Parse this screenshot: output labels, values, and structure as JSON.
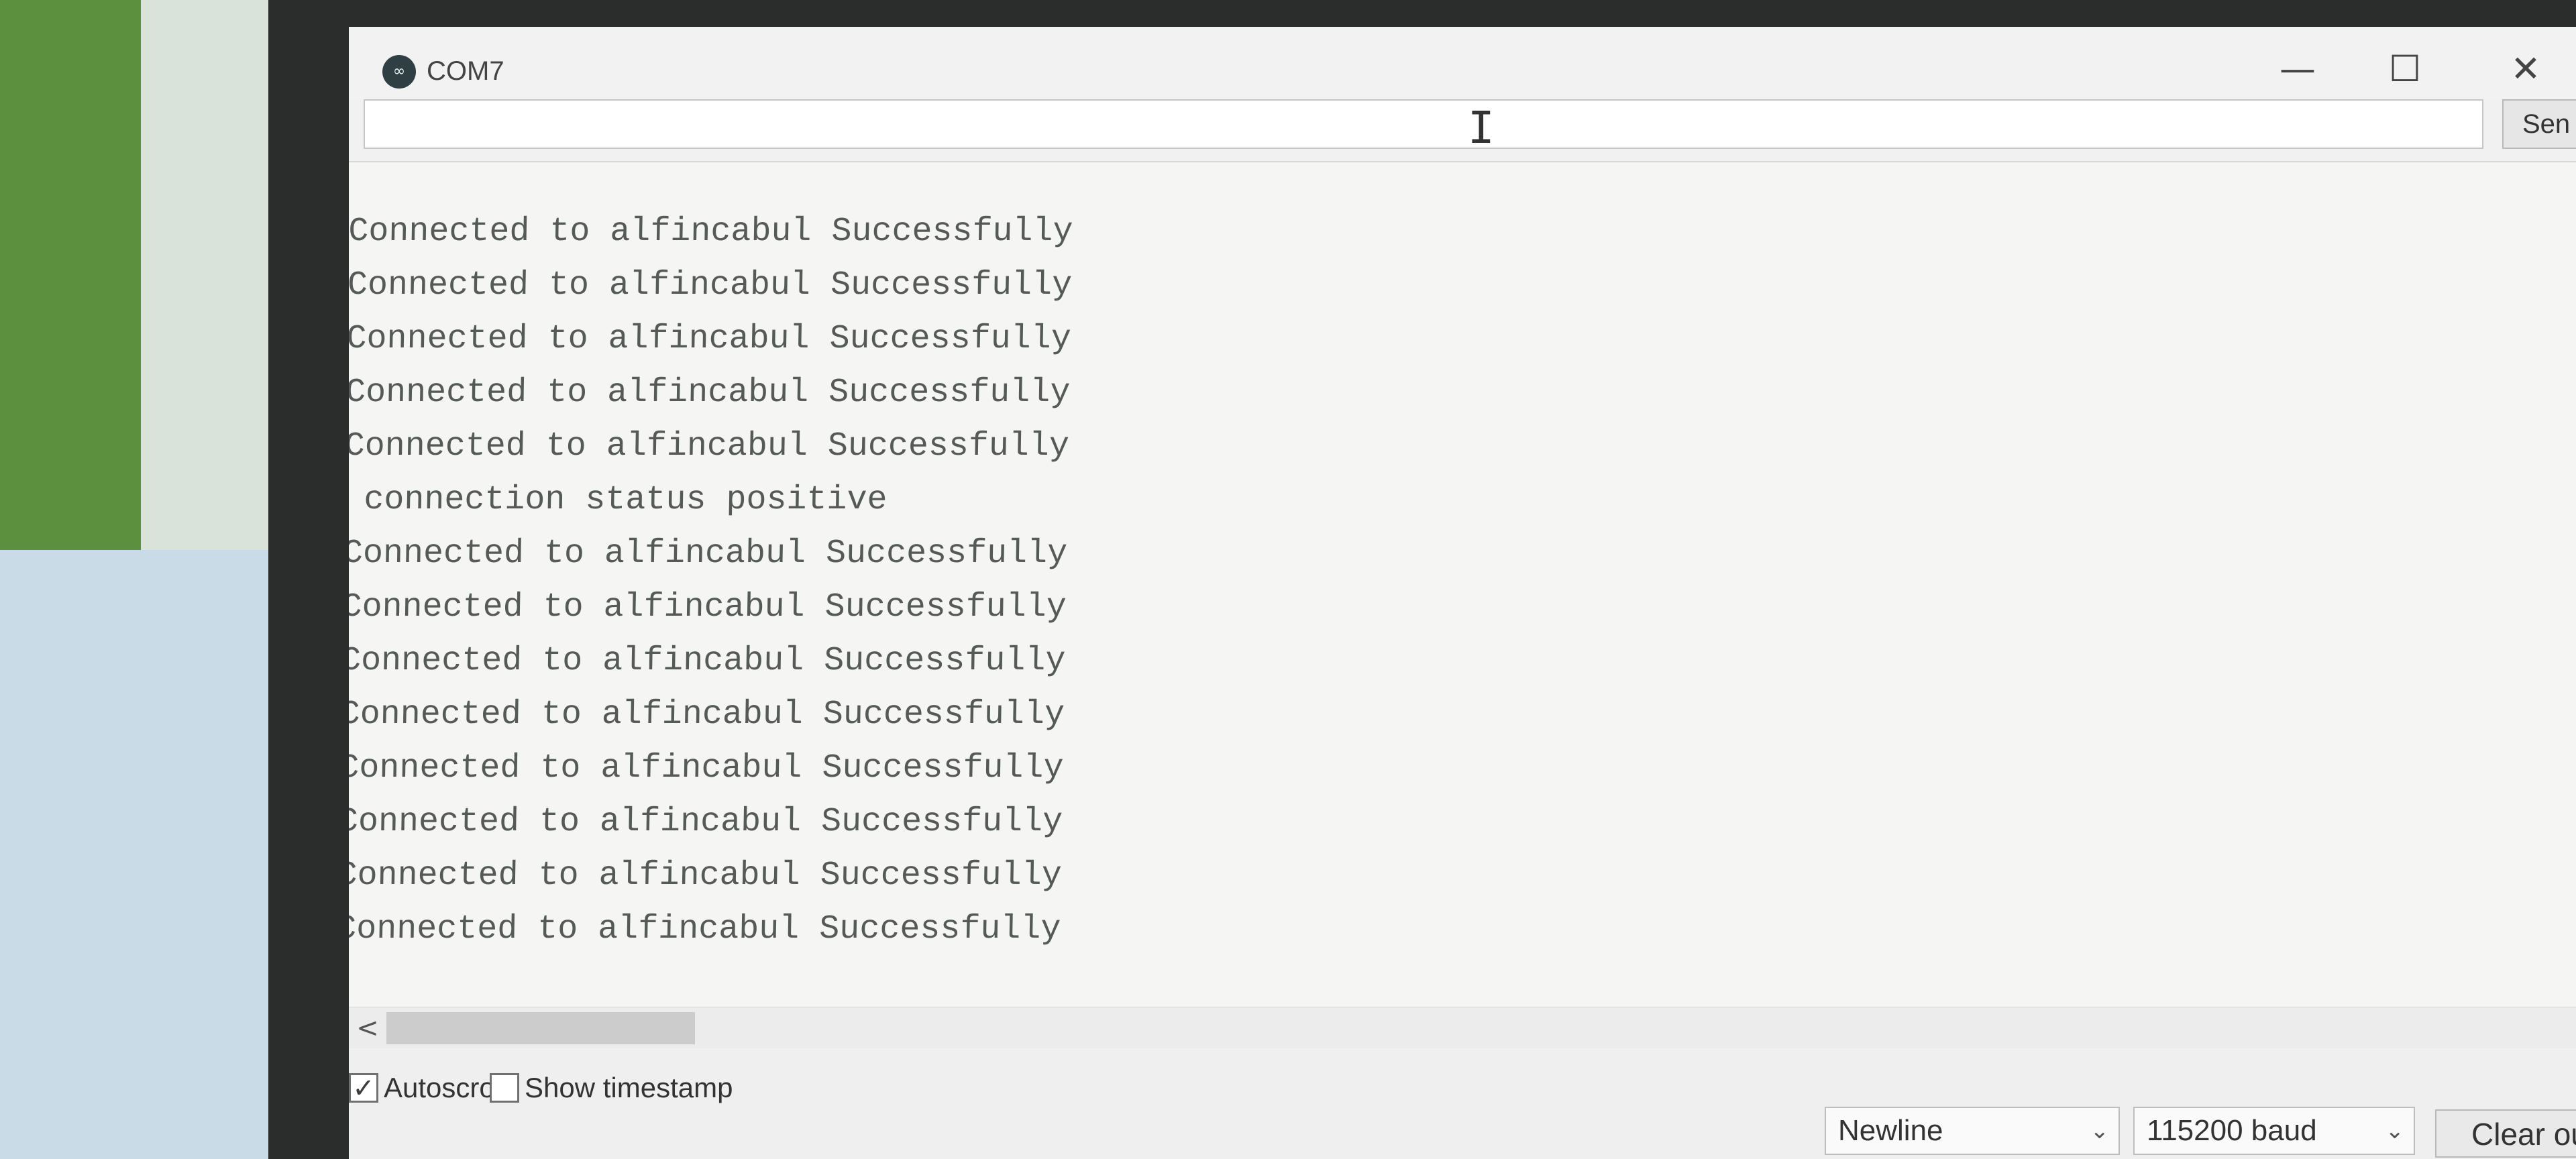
{
  "window": {
    "title": "COM7",
    "logo_glyph": "∞",
    "minimize_glyph": "—",
    "maximize_glyph": "☐",
    "close_glyph": "✕"
  },
  "send": {
    "input_value": "",
    "button_label": "Sen"
  },
  "output": {
    "lines": [
      "Connected to alfincabul Successfully",
      "Connected to alfincabul Successfully",
      "Connected to alfincabul Successfully",
      "Connected to alfincabul Successfully",
      "Connected to alfincabul Successfully",
      " connection status positive",
      "Connected to alfincabul Successfully",
      "Connected to alfincabul Successfully",
      "Connected to alfincabul Successfully",
      "Connected to alfincabul Successfully",
      "Connected to alfincabul Successfully",
      "Connected to alfincabul Successfully",
      "Connected to alfincabul Successfully",
      "Connected to alfincabul Successfully"
    ]
  },
  "scrollbar": {
    "left_arrow": "<"
  },
  "status": {
    "autoscroll_label": "Autoscroll",
    "autoscroll_checked": true,
    "autoscroll_mark": "✓",
    "timestamp_label": "Show timestamp",
    "timestamp_checked": false,
    "timestamp_mark": "",
    "line_ending": "Newline",
    "baud_rate": "115200 baud",
    "dropdown_glyph": "⌄",
    "clear_label": "Clear ou"
  },
  "colors": {
    "window_bg": "#f0f1f0",
    "output_bg": "#f5f6f4",
    "text": "#555a58"
  }
}
